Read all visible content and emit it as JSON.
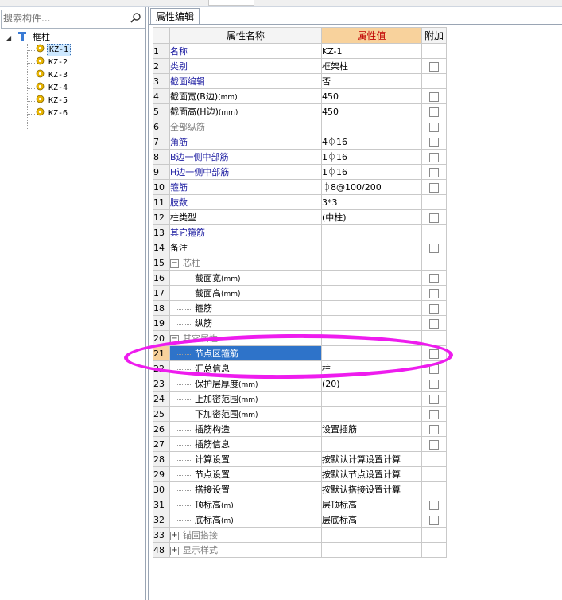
{
  "search": {
    "placeholder": "搜索构件..."
  },
  "tree": {
    "root": {
      "label": "框柱",
      "expand_symbol": "◢"
    },
    "items": [
      "KZ-1",
      "KZ-2",
      "KZ-3",
      "KZ-4",
      "KZ-5",
      "KZ-6"
    ],
    "selected": "KZ-1"
  },
  "tab": {
    "label": "属性编辑"
  },
  "grid": {
    "headers": {
      "name": "属性名称",
      "value": "属性值",
      "add": "附加"
    },
    "rows": [
      {
        "no": "1",
        "name": "名称",
        "value": "KZ-1",
        "check": false,
        "style": "blue"
      },
      {
        "no": "2",
        "name": "类别",
        "value": "框架柱",
        "check": true,
        "style": "blue"
      },
      {
        "no": "3",
        "name": "截面编辑",
        "value": "否",
        "check": false,
        "style": "blue"
      },
      {
        "no": "4",
        "name": "截面宽(B边)",
        "unit": "(mm)",
        "value": "450",
        "check": true,
        "style": "normal"
      },
      {
        "no": "5",
        "name": "截面高(H边)",
        "unit": "(mm)",
        "value": "450",
        "check": true,
        "style": "normal"
      },
      {
        "no": "6",
        "name": "全部纵筋",
        "value": "",
        "check": true,
        "style": "gray"
      },
      {
        "no": "7",
        "name": "角筋",
        "value": "4⏀16",
        "check": true,
        "style": "blue"
      },
      {
        "no": "8",
        "name": "B边一侧中部筋",
        "value": "1⏀16",
        "check": true,
        "style": "blue"
      },
      {
        "no": "9",
        "name": "H边一侧中部筋",
        "value": "1⏀16",
        "check": true,
        "style": "blue"
      },
      {
        "no": "10",
        "name": "箍筋",
        "value": "⏀8@100/200",
        "check": true,
        "style": "blue"
      },
      {
        "no": "11",
        "name": "肢数",
        "value": "3*3",
        "check": false,
        "style": "blue"
      },
      {
        "no": "12",
        "name": "柱类型",
        "value": "(中柱)",
        "check": true,
        "style": "normal"
      },
      {
        "no": "13",
        "name": "其它箍筋",
        "value": "",
        "check": false,
        "style": "blue"
      },
      {
        "no": "14",
        "name": "备注",
        "value": "",
        "check": true,
        "style": "normal"
      },
      {
        "no": "15",
        "name": "芯柱",
        "value": "",
        "check": false,
        "style": "group",
        "expander": "−"
      },
      {
        "no": "16",
        "name": "截面宽",
        "unit": "(mm)",
        "value": "",
        "check": true,
        "style": "child"
      },
      {
        "no": "17",
        "name": "截面高",
        "unit": "(mm)",
        "value": "",
        "check": true,
        "style": "child"
      },
      {
        "no": "18",
        "name": "箍筋",
        "value": "",
        "check": true,
        "style": "child"
      },
      {
        "no": "19",
        "name": "纵筋",
        "value": "",
        "check": true,
        "style": "child"
      },
      {
        "no": "20",
        "name": "其它属性",
        "value": "",
        "check": false,
        "style": "group",
        "expander": "−"
      },
      {
        "no": "21",
        "name": "节点区箍筋",
        "value": "",
        "check": true,
        "style": "child",
        "selected": true
      },
      {
        "no": "22",
        "name": "汇总信息",
        "value": "柱",
        "check": true,
        "style": "child"
      },
      {
        "no": "23",
        "name": "保护层厚度",
        "unit": "(mm)",
        "value": "(20)",
        "check": true,
        "style": "child"
      },
      {
        "no": "24",
        "name": "上加密范围",
        "unit": "(mm)",
        "value": "",
        "check": true,
        "style": "child"
      },
      {
        "no": "25",
        "name": "下加密范围",
        "unit": "(mm)",
        "value": "",
        "check": true,
        "style": "child"
      },
      {
        "no": "26",
        "name": "插筋构造",
        "value": "设置插筋",
        "check": true,
        "style": "child"
      },
      {
        "no": "27",
        "name": "插筋信息",
        "value": "",
        "check": true,
        "style": "child"
      },
      {
        "no": "28",
        "name": "计算设置",
        "value": "按默认计算设置计算",
        "check": false,
        "style": "child"
      },
      {
        "no": "29",
        "name": "节点设置",
        "value": "按默认节点设置计算",
        "check": false,
        "style": "child"
      },
      {
        "no": "30",
        "name": "搭接设置",
        "value": "按默认搭接设置计算",
        "check": false,
        "style": "child"
      },
      {
        "no": "31",
        "name": "顶标高",
        "unit": "(m)",
        "value": "层顶标高",
        "check": true,
        "style": "child"
      },
      {
        "no": "32",
        "name": "底标高",
        "unit": "(m)",
        "value": "层底标高",
        "check": true,
        "style": "child"
      },
      {
        "no": "33",
        "name": "锚固搭接",
        "value": "",
        "check": false,
        "style": "group",
        "expander": "+"
      },
      {
        "no": "48",
        "name": "显示样式",
        "value": "",
        "check": false,
        "style": "group",
        "expander": "+"
      }
    ]
  },
  "colors": {
    "annotation": "#ee1cee",
    "header_value_bg": "#f8d29c",
    "selection": "#2e73c9",
    "link_blue": "#1a1aa0"
  },
  "icons": {
    "search": "search-icon",
    "tree_root": "column-icon",
    "tree_item": "gear-icon"
  }
}
